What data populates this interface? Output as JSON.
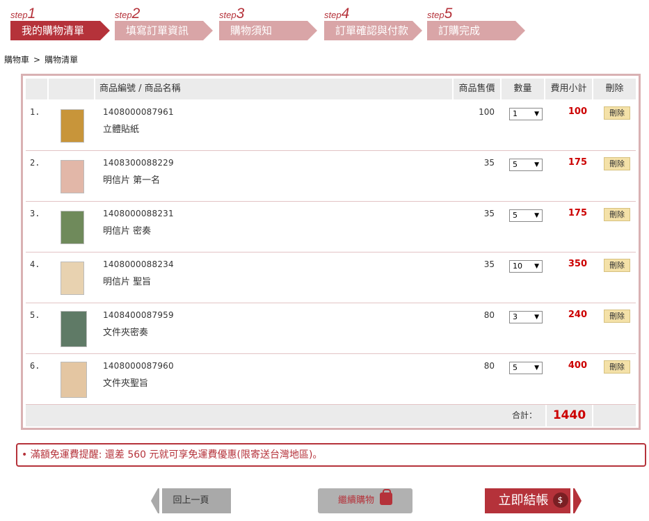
{
  "steps": [
    {
      "word": "step",
      "num": "1",
      "label": "我的購物清單",
      "active": true
    },
    {
      "word": "step",
      "num": "2",
      "label": "填寫訂單資訊",
      "active": false
    },
    {
      "word": "step",
      "num": "3",
      "label": "購物須知",
      "active": false
    },
    {
      "word": "step",
      "num": "4",
      "label": "訂單確認與付款",
      "active": false
    },
    {
      "word": "step",
      "num": "5",
      "label": "訂購完成",
      "active": false
    }
  ],
  "breadcrumb": {
    "root": "購物車",
    "sep": ">",
    "current": "購物清單"
  },
  "table": {
    "headers": {
      "product": "商品編號 / 商品名稱",
      "price": "商品售價",
      "qty": "數量",
      "subtotal": "費用小計",
      "delete": "刪除"
    },
    "rows": [
      {
        "idx": "1.",
        "code": "1408000087961",
        "name": "立體貼紙",
        "price": "100",
        "qty": "1",
        "subtotal": "100",
        "delete_label": "刪除",
        "thumb_color": "#c8953a"
      },
      {
        "idx": "2.",
        "code": "1408300088229",
        "name": "明信片 第一名",
        "price": "35",
        "qty": "5",
        "subtotal": "175",
        "delete_label": "刪除",
        "thumb_color": "#e2b7a8"
      },
      {
        "idx": "3.",
        "code": "1408000088231",
        "name": "明信片 密奏",
        "price": "35",
        "qty": "5",
        "subtotal": "175",
        "delete_label": "刪除",
        "thumb_color": "#6f8a5b"
      },
      {
        "idx": "4.",
        "code": "1408000088234",
        "name": "明信片 聖旨",
        "price": "35",
        "qty": "10",
        "subtotal": "350",
        "delete_label": "刪除",
        "thumb_color": "#e8d2b0"
      },
      {
        "idx": "5.",
        "code": "1408400087959",
        "name": "文件夾密奏",
        "price": "80",
        "qty": "3",
        "subtotal": "240",
        "delete_label": "刪除",
        "thumb_color": "#5f7a66"
      },
      {
        "idx": "6.",
        "code": "1408000087960",
        "name": "文件夾聖旨",
        "price": "80",
        "qty": "5",
        "subtotal": "400",
        "delete_label": "刪除",
        "thumb_color": "#e4c6a2"
      }
    ],
    "total_label": "合計：",
    "total_value": "1440"
  },
  "notice": "• 滿額免運費提醒: 還差 560 元就可享免運費優惠(限寄送台灣地區)。",
  "buttons": {
    "back": "回上一頁",
    "continue": "繼續購物",
    "checkout": "立即結帳",
    "checkout_icon": "$"
  },
  "colors": {
    "accent": "#b5323a",
    "step_inactive": "#d9a5a7",
    "subtotal": "#cc0000",
    "delete_bg": "#f4e1a8"
  }
}
